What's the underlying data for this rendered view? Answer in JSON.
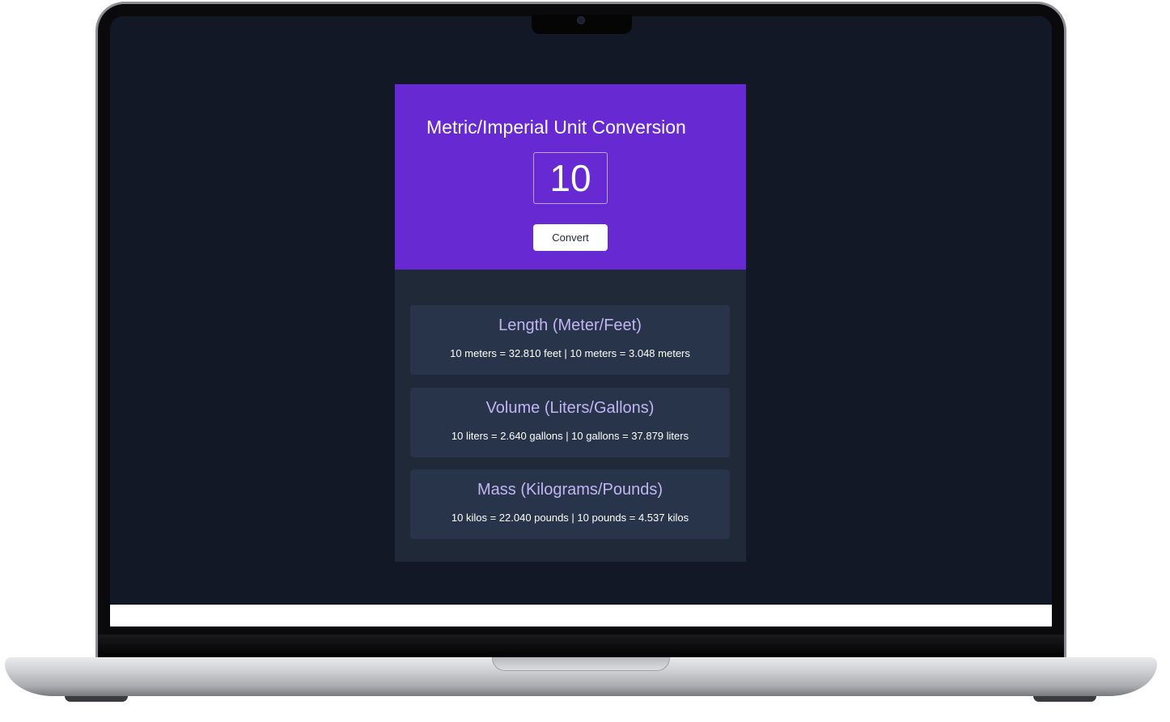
{
  "app": {
    "title": "Metric/Imperial Unit Conversion",
    "input_value": "10",
    "convert_label": "Convert"
  },
  "cards": [
    {
      "title": "Length (Meter/Feet)",
      "text": "10 meters = 32.810 feet | 10 meters = 3.048 meters"
    },
    {
      "title": "Volume (Liters/Gallons)",
      "text": "10 liters = 2.640 gallons | 10 gallons = 37.879 liters"
    },
    {
      "title": "Mass (Kilograms/Pounds)",
      "text": "10 kilos = 22.040 pounds | 10 pounds = 4.537 kilos"
    }
  ],
  "colors": {
    "hero_purple": "#6729d1",
    "page_background": "#121826",
    "panel_background": "#1f2937",
    "card_background": "#273449",
    "card_title": "#c2b5f4"
  }
}
